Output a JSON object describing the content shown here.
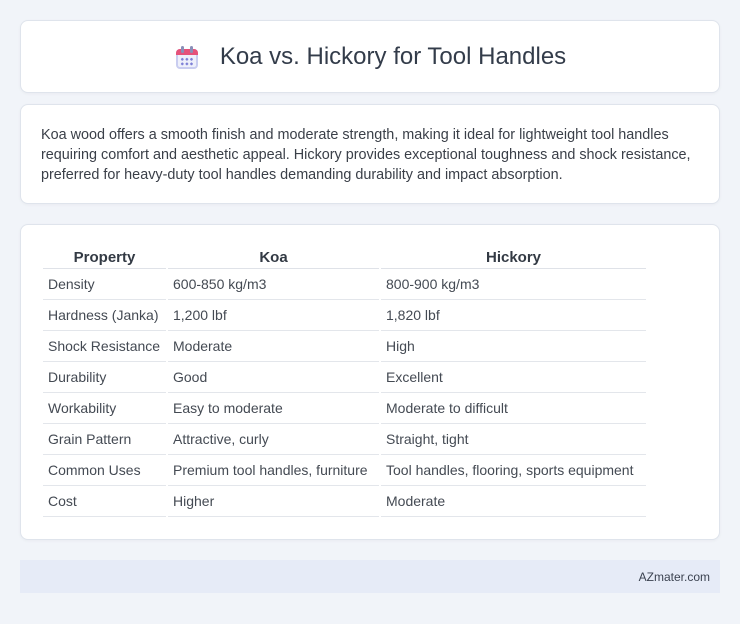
{
  "header": {
    "title": "Koa vs. Hickory for Tool Handles",
    "icon": "calendar-icon"
  },
  "intro": "Koa wood offers a smooth finish and moderate strength, making it ideal for lightweight tool handles requiring comfort and aesthetic appeal. Hickory provides exceptional toughness and shock resistance, preferred for heavy-duty tool handles demanding durability and impact absorption.",
  "table": {
    "headers": [
      "Property",
      "Koa",
      "Hickory"
    ],
    "rows": [
      [
        "Density",
        "600-850 kg/m3",
        "800-900 kg/m3"
      ],
      [
        "Hardness (Janka)",
        "1,200 lbf",
        "1,820 lbf"
      ],
      [
        "Shock Resistance",
        "Moderate",
        "High"
      ],
      [
        "Durability",
        "Good",
        "Excellent"
      ],
      [
        "Workability",
        "Easy to moderate",
        "Moderate to difficult"
      ],
      [
        "Grain Pattern",
        "Attractive, curly",
        "Straight, tight"
      ],
      [
        "Common Uses",
        "Premium tool handles, furniture",
        "Tool handles, flooring, sports equipment"
      ],
      [
        "Cost",
        "Higher",
        "Moderate"
      ]
    ]
  },
  "footer": {
    "brand": "AZmater.com"
  }
}
